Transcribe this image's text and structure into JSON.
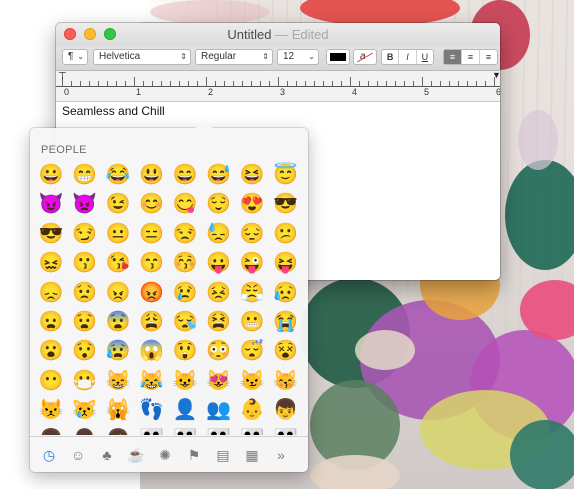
{
  "window": {
    "title": "Untitled",
    "edited_label": "— Edited",
    "toolbar": {
      "paragraph_label": "¶",
      "font_family": "Helvetica",
      "font_style": "Regular",
      "font_size": "12",
      "bold_label": "B",
      "italic_label": "I",
      "underline_label": "U",
      "strike_label": "a"
    },
    "ruler_numbers": [
      "0",
      "1",
      "2",
      "3",
      "4",
      "5",
      "6"
    ],
    "document_text": "Seamless and Chill"
  },
  "emoji_panel": {
    "section_title": "PEOPLE",
    "emojis": [
      "😀",
      "😁",
      "😂",
      "😃",
      "😄",
      "😅",
      "😆",
      "😇",
      "😈",
      "👿",
      "😉",
      "😊",
      "😋",
      "😌",
      "😍",
      "😎",
      "😎",
      "😏",
      "😐",
      "😑",
      "😒",
      "😓",
      "😔",
      "😕",
      "😖",
      "😗",
      "😘",
      "😙",
      "😚",
      "😛",
      "😜",
      "😝",
      "😞",
      "😟",
      "😠",
      "😡",
      "😢",
      "😣",
      "😤",
      "😥",
      "😦",
      "😧",
      "😨",
      "😩",
      "😪",
      "😫",
      "😬",
      "😭",
      "😮",
      "😯",
      "😰",
      "😱",
      "😲",
      "😳",
      "😴",
      "😵",
      "😶",
      "😷",
      "😸",
      "😹",
      "😺",
      "😻",
      "😼",
      "😽",
      "😾",
      "😿",
      "🙀",
      "👣",
      "👤",
      "👥",
      "👶",
      "👦",
      "👧",
      "👨",
      "👩",
      "👪",
      "👪",
      "👪",
      "👪",
      "👪",
      "👨",
      "👨",
      "👨",
      "👨",
      "👨",
      "👨",
      "👨",
      "👨"
    ],
    "categories": [
      {
        "name": "recent",
        "glyph": "◷"
      },
      {
        "name": "people",
        "glyph": "☺"
      },
      {
        "name": "nature",
        "glyph": "♣"
      },
      {
        "name": "food",
        "glyph": "☕"
      },
      {
        "name": "celebration",
        "glyph": "✺"
      },
      {
        "name": "activity",
        "glyph": "⚑"
      },
      {
        "name": "travel",
        "glyph": "▤"
      },
      {
        "name": "symbols",
        "glyph": "▦"
      },
      {
        "name": "more",
        "glyph": "»"
      }
    ]
  }
}
